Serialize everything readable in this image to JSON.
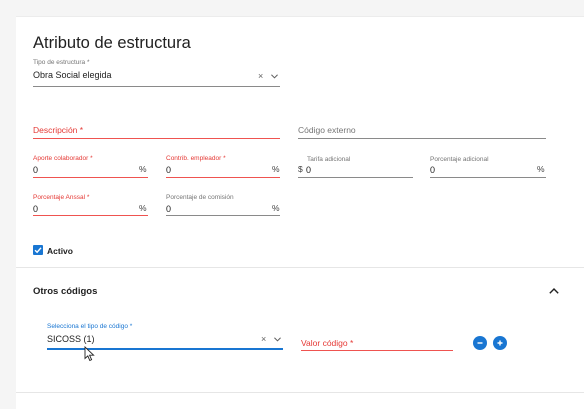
{
  "form": {
    "title": "Atributo de estructura",
    "tipo_estructura": {
      "label": "Tipo de estructura *",
      "value": "Obra Social elegida"
    },
    "descripcion": {
      "label": "Descripción *"
    },
    "codigo_externo": {
      "label": "Código externo"
    },
    "aporte_colaborador": {
      "label": "Aporte colaborador *",
      "value": "0",
      "suffix": "%"
    },
    "contrib_empleador": {
      "label": "Contrib. empleador *",
      "value": "0",
      "suffix": "%"
    },
    "tarifa_adicional": {
      "label": "Tarifa adicional",
      "prefix": "$",
      "value": "0"
    },
    "porcentaje_adicional": {
      "label": "Porcentaje adicional",
      "value": "0",
      "suffix": "%"
    },
    "porcentaje_anssal": {
      "label": "Porcentaje Anssal *",
      "value": "0",
      "suffix": "%"
    },
    "porcentaje_comision": {
      "label": "Porcentaje de comisión",
      "value": "0",
      "suffix": "%"
    },
    "activo": {
      "label": "Activo",
      "checked": true
    }
  },
  "otros_codigos": {
    "title": "Otros códigos",
    "tipo_codigo": {
      "label": "Selecciona el tipo de código *",
      "value": "SICOSS (1)"
    },
    "valor_codigo": {
      "label": "Valor código *"
    }
  },
  "icons": {
    "clear": "×",
    "dropdown": "chevron-down-icon",
    "collapse": "chevron-up-icon",
    "remove": "minus-icon",
    "add": "plus-icon"
  },
  "colors": {
    "accent": "#1976d2",
    "error": "#e53935"
  }
}
